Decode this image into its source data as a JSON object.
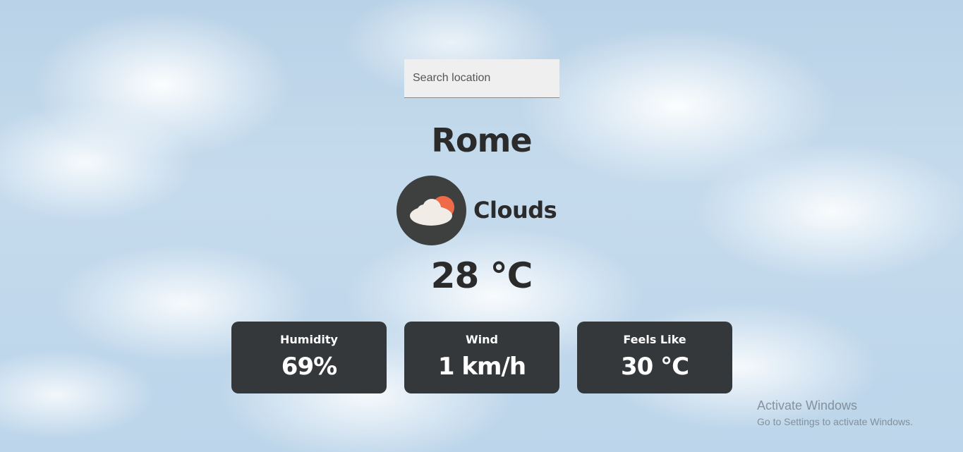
{
  "search": {
    "placeholder": "Search location",
    "value": ""
  },
  "weather": {
    "city": "Rome",
    "condition": "Clouds",
    "condition_icon": "cloud-sun-icon",
    "temperature": "28 °C"
  },
  "stats": [
    {
      "label": "Humidity",
      "value": "69%"
    },
    {
      "label": "Wind",
      "value": "1 km/h"
    },
    {
      "label": "Feels Like",
      "value": "30 °C"
    }
  ],
  "watermark": {
    "title": "Activate Windows",
    "subtitle": "Go to Settings to activate Windows."
  },
  "colors": {
    "card_bg": "#35383a",
    "text_dark": "#2b2b2b",
    "sun": "#ee6a48",
    "cloud": "#f1ede6"
  }
}
